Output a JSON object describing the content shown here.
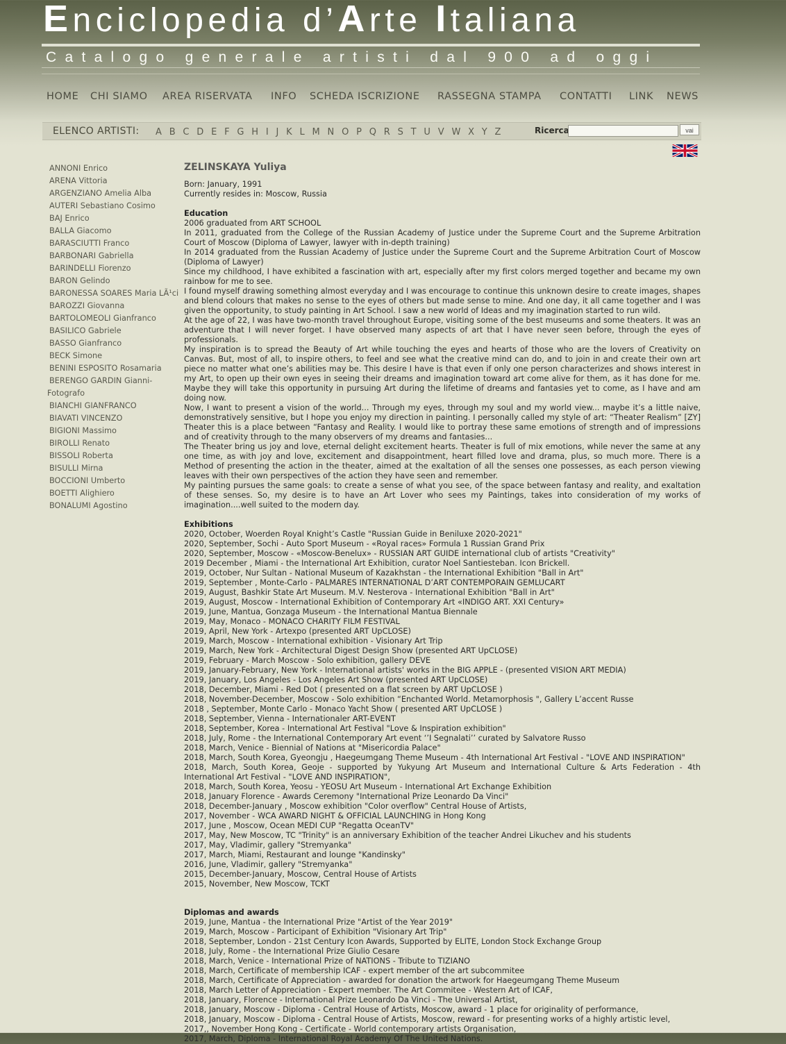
{
  "header": {
    "title_E": "E",
    "title_part1": "nciclopedia d’",
    "title_A": "A",
    "title_part2": "rte ",
    "title_I": "I",
    "title_part3": "taliana",
    "subtitle": "Catalogo generale artisti dal 900 ad oggi"
  },
  "nav": {
    "home": "HOME",
    "chi_siamo": "CHI SIAMO",
    "area_riservata": "AREA RISERVATA",
    "info": "INFO",
    "scheda": "SCHEDA ISCRIZIONE",
    "rassegna": "RASSEGNA STAMPA",
    "contatti": "CONTATTI",
    "link": "LINK",
    "news": "NEWS"
  },
  "alphabar": {
    "label": "ELENCO ARTISTI:",
    "letters": [
      "A",
      "B",
      "C",
      "D",
      "E",
      "F",
      "G",
      "H",
      "I",
      "J",
      "K",
      "L",
      "M",
      "N",
      "O",
      "P",
      "Q",
      "R",
      "S",
      "T",
      "U",
      "V",
      "W",
      "X",
      "Y",
      "Z"
    ],
    "search_label": "Ricerca",
    "search_value": "",
    "search_button": "vai"
  },
  "flag_icon": "uk-flag-icon",
  "sidebar": {
    "artists": [
      "ANNONI Enrico",
      "ARENA Vittoria",
      "ARGENZIANO Amelia Alba",
      "AUTERI Sebastiano Cosimo",
      "BAJ Enrico",
      "BALLA Giacomo",
      "BARASCIUTTI Franco",
      "BARBONARI Gabriella",
      "BARINDELLI Fiorenzo",
      "BARON Gelindo",
      "BARONESSA SOARES Maria LÃ¹ci",
      "BAROZZI Giovanna",
      "BARTOLOMEOLI Gianfranco",
      "BASILICO Gabriele",
      "BASSO Gianfranco",
      "BECK Simone",
      "BENINI ESPOSITO Rosamaria",
      "BERENGO GARDIN Gianni- Fotografo",
      "BIANCHI GIANFRANCO",
      "BIAVATI VINCENZO",
      "BIGIONI Massimo",
      "BIROLLI Renato",
      "BISSOLI Roberta",
      "BISULLI Mirna",
      "BOCCIONI Umberto",
      "BOETTI Alighiero",
      "BONALUMI Agostino"
    ]
  },
  "artist": {
    "name": "ZELINSKAYA Yuliya",
    "born": "Born: January, 1991",
    "resides": "Currently resides in: Moscow, Russia"
  },
  "education": {
    "heading": "Education",
    "lines": [
      "2006 graduated from ART SCHOOL",
      "In 2011, graduated from the College of the Russian Academy of Justice under the Supreme Court and the Supreme Arbitration Court of Moscow (Diploma of Lawyer, lawyer with in-depth training)",
      "In 2014 graduated from the Russian Academy of Justice under the Supreme Court and the Supreme Arbitration Court of Moscow (Diploma of Lawyer)",
      "Since my childhood, I have exhibited a fascination with art, especially after my first colors merged together and became my own rainbow for me to see.",
      "I found myself drawing something almost everyday and I was encourage to continue this unknown desire to create images, shapes and blend colours that makes no sense to the eyes of others but made sense to mine. And one day, it all came together and I was given the opportunity, to study painting in Art School. I saw a new world of Ideas and my imagination started to run wild.",
      "At the age of 22, I was have two-month travel throughout Europe, visiting some of the best museums and some theaters. It was an adventure that I will never forget. I have observed many aspects of art that I have never seen before, through the eyes of professionals.",
      "My inspiration is to spread the Beauty of Art while touching the eyes and hearts of those who are the lovers of Creativity on Canvas. But, most of all, to inspire others, to feel and see what the creative mind can do, and to join in and create their own art piece no matter what one’s abilities may be. This desire I have is that even if only one person characterizes and shows interest in my Art, to open up their own eyes in seeing their dreams and imagination toward art come alive for them, as it has done for me. Maybe they will take this opportunity in pursuing Art during the lifetime of dreams and fantasies yet to come, as I have and am doing now.",
      "Now, I want to present a vision of the world... Through my eyes, through my soul and my world view... maybe it’s a little naive, demonstratively sensitive, but I hope you enjoy my direction in painting. I personally called my style of art: “Theater Realism” [ZY] Theater this is a place between “Fantasy and Reality. I would like to portray these same emotions of strength and of impressions and of creativity through to the many observers of my dreams and fantasies...",
      "The Theater bring us joy and love, eternal delight excitement hearts. Theater is full of mix emotions, while never the same at any one time, as with joy and love, excitement and disappointment, heart filled love and drama, plus, so much more. There is a Method of presenting the action in the theater, aimed at the exaltation of all the senses one possesses, as each person viewing leaves with their own perspectives of the action they have seen and remember.",
      "My painting pursues the same goals: to create a sense of what you see, of the space between fantasy and reality, and exaltation of these senses. So, my desire is to have an Art Lover who sees my Paintings, takes into consideration of my works of imagination....well suited to the modern day."
    ]
  },
  "exhibitions": {
    "heading": "Exhibitions",
    "lines": [
      "2020, October, Woerden Royal Knight’s Castle \"Russian Guide in Beniluxe 2020-2021\"",
      "2020, September, Sochi - Auto Sport Museum - «Royal races» Formula 1 Russian Grand Prix",
      "2020, September, Moscow - «Moscow-Benelux» - RUSSIAN ART GUIDE international club of artists \"Creativity\"",
      "2019 December , Miami - the International Art Exhibition, curator Noel Santiesteban. Icon Brickell.",
      "2019, October, Nur Sultan - National Museum of Kazakhstan - the International Exhibition \"Ball in Art\"",
      "2019, September , Monte-Carlo - PALMARES INTERNATIONAL D’ART CONTEMPORAIN GEMLUCART",
      "2019, August, Bashkir State Art Museum. M.V. Nesterova - International Exhibition \"Ball in Art\"",
      "2019, August, Moscow - International Exhibition of Contemporary Art «INDIGO ART. XXI Century»",
      "2019, June, Mantua, Gonzaga Museum - the International Mantua Biennale",
      "2019, May, Monaco - MONACO CHARITY FILM FESTIVAL",
      "2019, April, New York - Artexpo (presented ART UpCLOSE)",
      "2019, March, Moscow - International exhibition - Visionary Art Trip",
      "2019, March, New York - Architectural Digest Design Show (presented ART UpCLOSE)",
      "2019, February - March Moscow - Solo exhibition, gallery DEVE",
      "2019, January-February, New York - International artists' works in the BIG APPLE - (presented VISION ART MEDIA)",
      "2019, January, Los Angeles - Los Angeles Art Show (presented ART UpCLOSE)",
      "2018, December, Miami - Red Dot ( presented on a flat screen by ART UpCLOSE )",
      "2018, November-December, Moscow - Solo exhibition “Enchanted World. Metamorphosis \", Gallery L’accent Russe",
      "2018 , September, Monte Carlo - Monaco Yacht Show ( presented ART UpCLOSE )",
      "2018, September, Vienna - Internationaler ART-EVENT",
      "2018, September, Korea - International Art Festival \"Love & Inspiration exhibition\"",
      "2018, July, Rome - the International Contemporary Art event ‘’I Segnalati’’ curated by Salvatore Russo",
      "2018, March, Venice - Biennial of Nations at \"Misericordia Palace\"",
      "2018, March, South Korea, Gyeongju , Haegeumgang Theme Museum - 4th International Art Festival - \"LOVE AND INSPIRATION\"",
      "2018, March, South Korea, Geoje - supported by Yukyung Art Museum and International Culture & Arts Federation - 4th International Art Festival - \"LOVE AND INSPIRATION\",",
      "2018, March, South Korea, Yeosu - YEOSU Art Museum - International Art Exchange Exhibition",
      "2018, January Florence - Awards Ceremony \"International Prize Leonardo Da Vinci\"",
      "2018, December-January , Moscow exhibition \"Color overflow\" Central House of Artists,",
      "2017, November - WCA AWARD NIGHT & OFFICIAL LAUNCHING in Hong Kong",
      "2017, June , Moscow, Ocean MEDI CUP \"Regatta OceanTV\"",
      "2017, May, New Moscow, TC \"Trinity\" is an anniversary Exhibition of the teacher Andrei Likuchev and his students",
      "2017, May, Vladimir, gallery \"Stremyanka\"",
      "2017, March, Miami, Restaurant and lounge \"Kandinsky\"",
      "2016, June, Vladimir, gallery \"Stremyanka\"",
      "2015, December-January, Moscow, Central House of Artists",
      "2015, November, New Moscow, TCKT"
    ]
  },
  "diplomas": {
    "heading": "Diplomas and awards",
    "lines": [
      "2019, June, Mantua - the International Prize \"Artist of the Year 2019\"",
      "2019, March, Moscow - Participant of Exhibition \"Visionary Art Trip\"",
      "2018, September, London - 21st Century Icon Awards, Supported by ELITE, London Stock Exchange Group",
      "2018, July, Rome - the International Prize Giulio Cesare",
      "2018, March, Venice - International Prize of NATIONS - Tribute to TIZIANO",
      "2018, March, Certificate of membership ICAF - expert member of the art subcommitee",
      "2018, March, Certificate of Appreciation - awarded for donation the artwork for Haegeumgang Theme Museum",
      "2018, March Letter of Appreciation - Expert member. The Art Commitee - Western Art of ICAF,",
      "2018, January, Florence - International Prize Leonardo Da Vinci - The Universal Artist,",
      "2018, January, Moscow - Diploma - Central House of Artists, Moscow, award - 1 place for originality of performance,",
      "2018, January, Moscow - Diploma - Central House of Artists, Moscow, reward - for presenting works of a highly artistic level,",
      "2017,, November Hong Kong - Certificate - World contemporary artists Organisation,",
      "2017, March, Diploma - International Royal Academy Of The United Nations."
    ]
  }
}
